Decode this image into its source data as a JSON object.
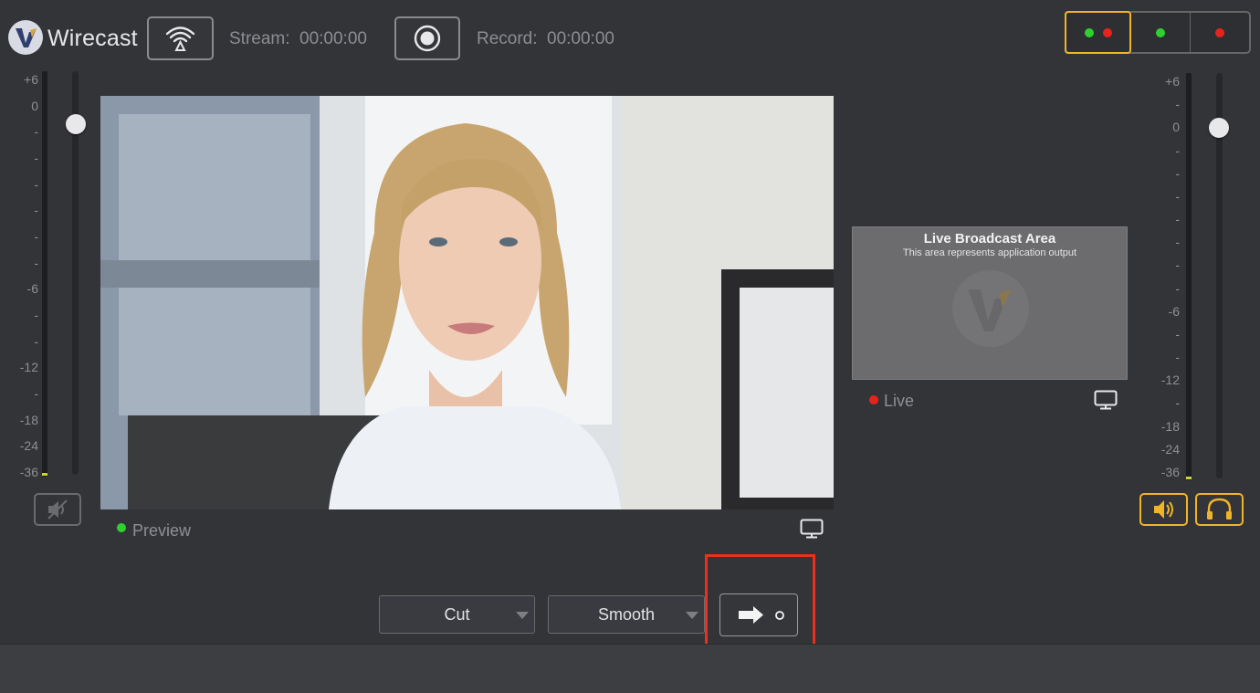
{
  "app": {
    "title": "Wirecast"
  },
  "toolbar": {
    "stream_label": "Stream:",
    "stream_time": "00:00:00",
    "record_label": "Record:",
    "record_time": "00:00:00",
    "stream_icon": "broadcast-wifi-icon",
    "record_icon": "record-icon"
  },
  "layout_modes": [
    {
      "name": "preview-and-live",
      "dots": [
        "#2ed12e",
        "#e8231d"
      ],
      "active": true
    },
    {
      "name": "preview-only",
      "dots": [
        "#2ed12e"
      ],
      "active": false
    },
    {
      "name": "live-only",
      "dots": [
        "#e8231d"
      ],
      "active": false
    }
  ],
  "left_meter": {
    "scale": [
      "+6",
      "0",
      "-",
      "-",
      "-",
      "-",
      "-",
      "-",
      "-6",
      "-",
      "-",
      "-12",
      "-",
      "-18",
      "-24",
      "-36"
    ],
    "mute_icon": "speaker-muted-icon"
  },
  "right_meter": {
    "scale": [
      "+6",
      "-",
      "0",
      "-",
      "-",
      "-",
      "-",
      "-",
      "-",
      "-",
      "-6",
      "-",
      "-",
      "-12",
      "-",
      "-18",
      "-24",
      "-36"
    ],
    "speaker_icon": "speaker-icon",
    "headphones_icon": "headphones-icon"
  },
  "preview": {
    "label": "Preview",
    "dot_color": "#2ed12e",
    "monitor_icon": "monitor-icon"
  },
  "live": {
    "title": "Live Broadcast Area",
    "subtitle": "This area represents application output",
    "label": "Live",
    "dot_color": "#e8231d",
    "monitor_icon": "monitor-icon"
  },
  "transitions": {
    "cut_label": "Cut",
    "smooth_label": "Smooth",
    "go_icon": "arrow-right-icon"
  },
  "colors": {
    "accent": "#f0b429",
    "highlight": "#e8321d",
    "background": "#333438"
  }
}
